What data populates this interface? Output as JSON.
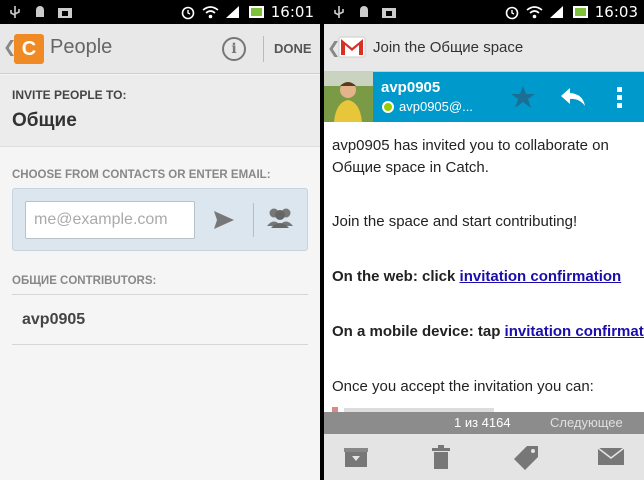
{
  "status": {
    "left_time": "16:01",
    "right_time": "16:03"
  },
  "people": {
    "title": "People",
    "done_label": "DONE",
    "invite_label": "INVITE PEOPLE TO:",
    "space_name": "Общие",
    "choose_label": "CHOOSE FROM CONTACTS OR ENTER EMAIL:",
    "email_placeholder": "me@example.com",
    "contributors_label": "ОБЩИЕ CONTRIBUTORS:",
    "contributors": [
      "avp0905"
    ]
  },
  "gmail": {
    "title": "Join the Общие space",
    "sender_name": "avp0905",
    "sender_email": "avp0905@...",
    "body": {
      "line1": "avp0905 has invited you to collaborate on",
      "line2": "Общие space in Catch.",
      "line3": "Join the space and start contributing!",
      "web_prefix": "On the web: click ",
      "web_link": "invitation confirmation",
      "mobile_prefix": "On a mobile device: tap ",
      "mobile_link": "invitation confirmation",
      "line6": "Once you accept the invitation you can:"
    },
    "pager_count": "1 из 4164",
    "pager_next": "Следующее"
  },
  "colors": {
    "catch_orange": "#f08a24",
    "sender_bar_blue": "#0099cc",
    "presence_green": "#99cc00",
    "link": "#1a0dab"
  },
  "icons": [
    "usb-icon",
    "android-icon",
    "bag-icon",
    "alarm-icon",
    "wifi-icon",
    "signal-icon",
    "battery-icon",
    "info-icon",
    "send-icon",
    "contacts-icon",
    "gmail-icon",
    "star-icon",
    "reply-icon",
    "more-icon",
    "archive-icon",
    "trash-icon",
    "label-icon",
    "mail-icon"
  ]
}
